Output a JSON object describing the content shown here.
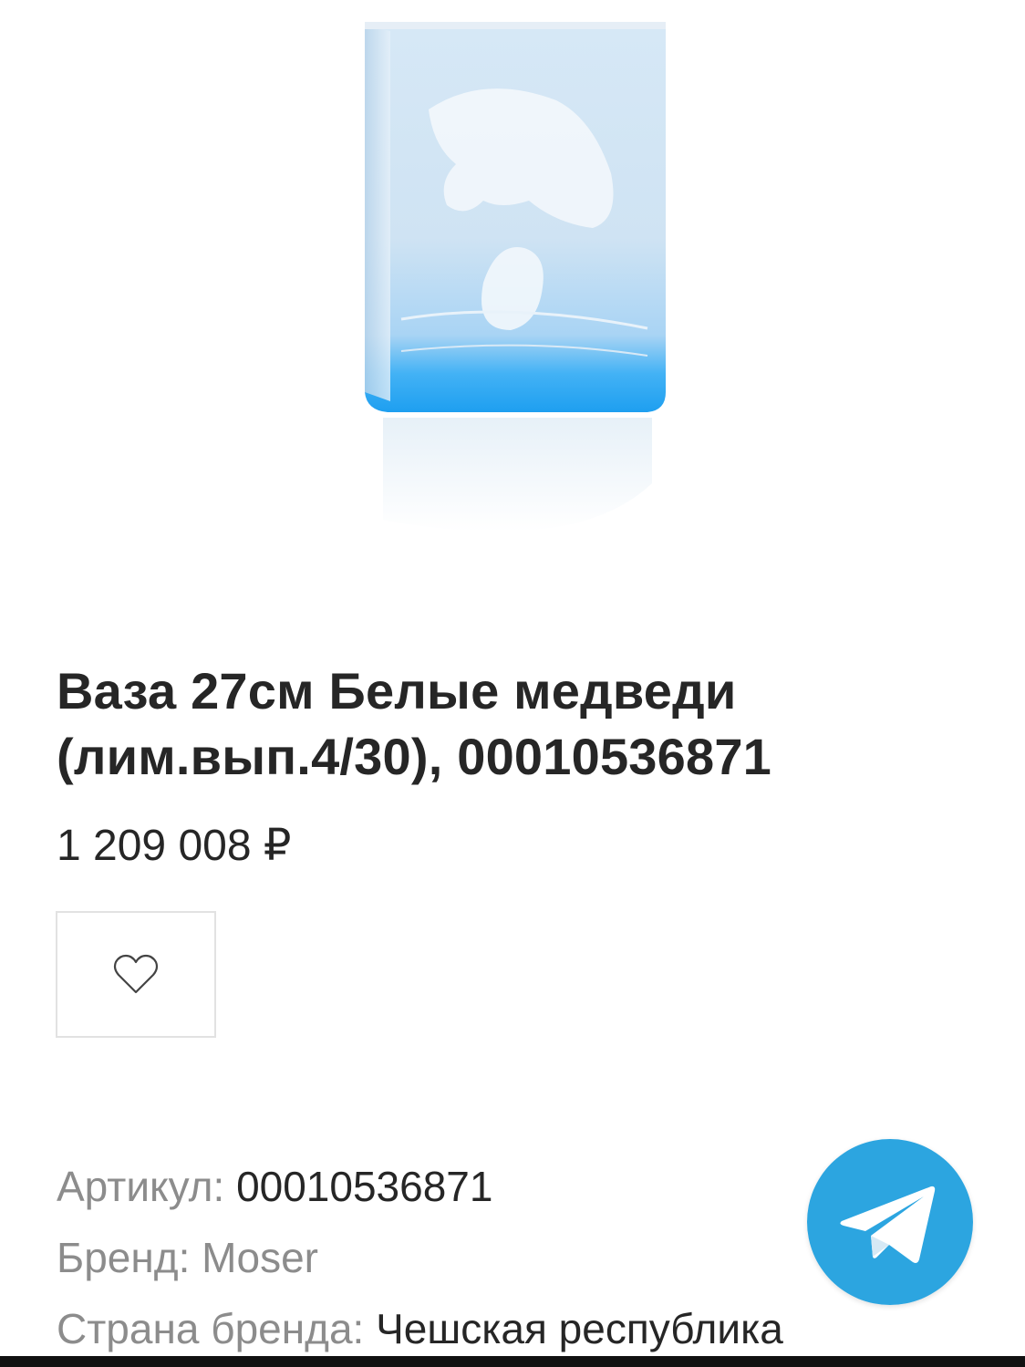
{
  "product": {
    "title_line1": "Ваза 27см Белые медведи",
    "title_line2": "(лим.вып.4/30), 00010536871",
    "price": "1 209 008 ₽"
  },
  "specs": [
    {
      "label": "Артикул:",
      "value": "00010536871"
    },
    {
      "label": "Бренд:",
      "value": "Moser"
    },
    {
      "label": "Страна бренда:",
      "value": "Чешская республика"
    }
  ],
  "icons": {
    "favorite": "heart-icon",
    "telegram": "telegram-icon"
  },
  "colors": {
    "telegram": "#2ca5e0",
    "vase_blue": "#2fa7ef",
    "label_gray": "#8c8c8c",
    "text_dark": "#262626"
  }
}
